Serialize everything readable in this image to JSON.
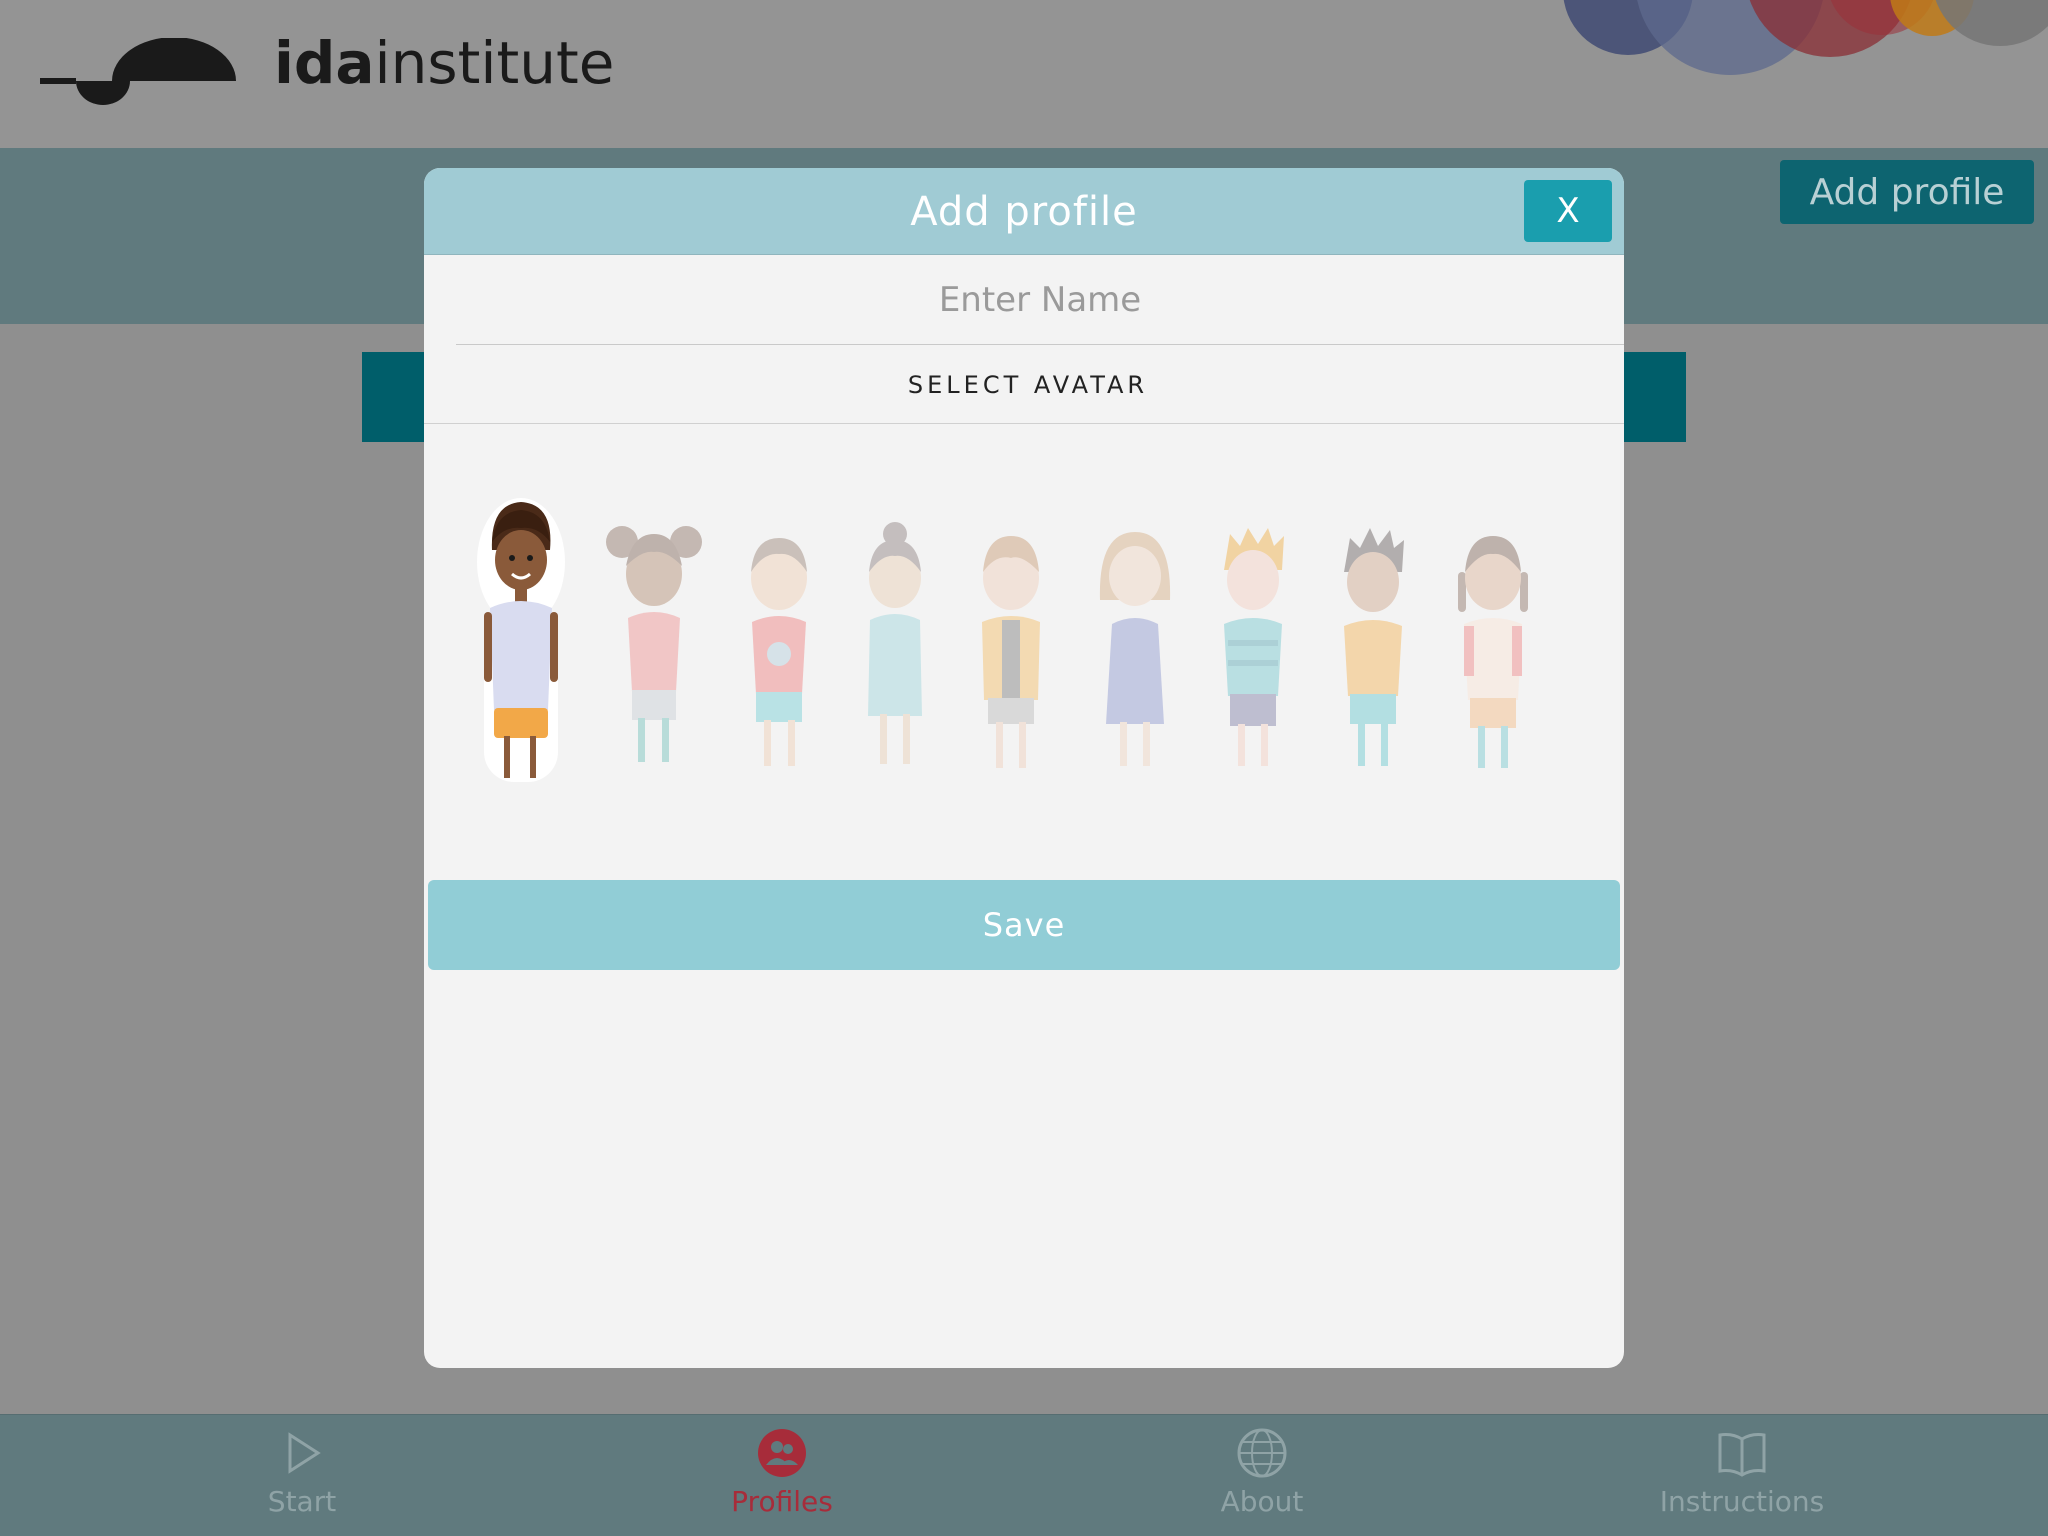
{
  "brand": {
    "logo_bold": "ida",
    "logo_light": "institute"
  },
  "header": {
    "add_profile_label": "Add profile"
  },
  "modal": {
    "title": "Add profile",
    "close_label": "X",
    "name_placeholder": "Enter Name",
    "name_value": "",
    "select_avatar_label": "SELECT AVATAR",
    "save_label": "Save",
    "avatars": [
      {
        "name": "boy-curly-hair",
        "selected": true
      },
      {
        "name": "girl-pigtail-buns",
        "selected": false
      },
      {
        "name": "girl-round-shirt",
        "selected": false
      },
      {
        "name": "girl-bun-dress",
        "selected": false
      },
      {
        "name": "boy-vest",
        "selected": false
      },
      {
        "name": "girl-long-hair-dress",
        "selected": false
      },
      {
        "name": "boy-blond-spiky",
        "selected": false
      },
      {
        "name": "boy-spiky-dark",
        "selected": false
      },
      {
        "name": "girl-braids",
        "selected": false
      }
    ]
  },
  "nav": {
    "items": [
      {
        "label": "Start",
        "icon": "play-icon",
        "active": false
      },
      {
        "label": "Profiles",
        "icon": "profiles-icon",
        "active": true
      },
      {
        "label": "About",
        "icon": "globe-icon",
        "active": false
      },
      {
        "label": "Instructions",
        "icon": "book-icon",
        "active": false
      }
    ]
  },
  "colors": {
    "header_bg": "#949494",
    "band_bg": "#607a7e",
    "modal_head": "#a0cbd4",
    "close_button": "#1a9eae",
    "save_button": "#91cdd6",
    "active_nav": "#a72c3a"
  }
}
